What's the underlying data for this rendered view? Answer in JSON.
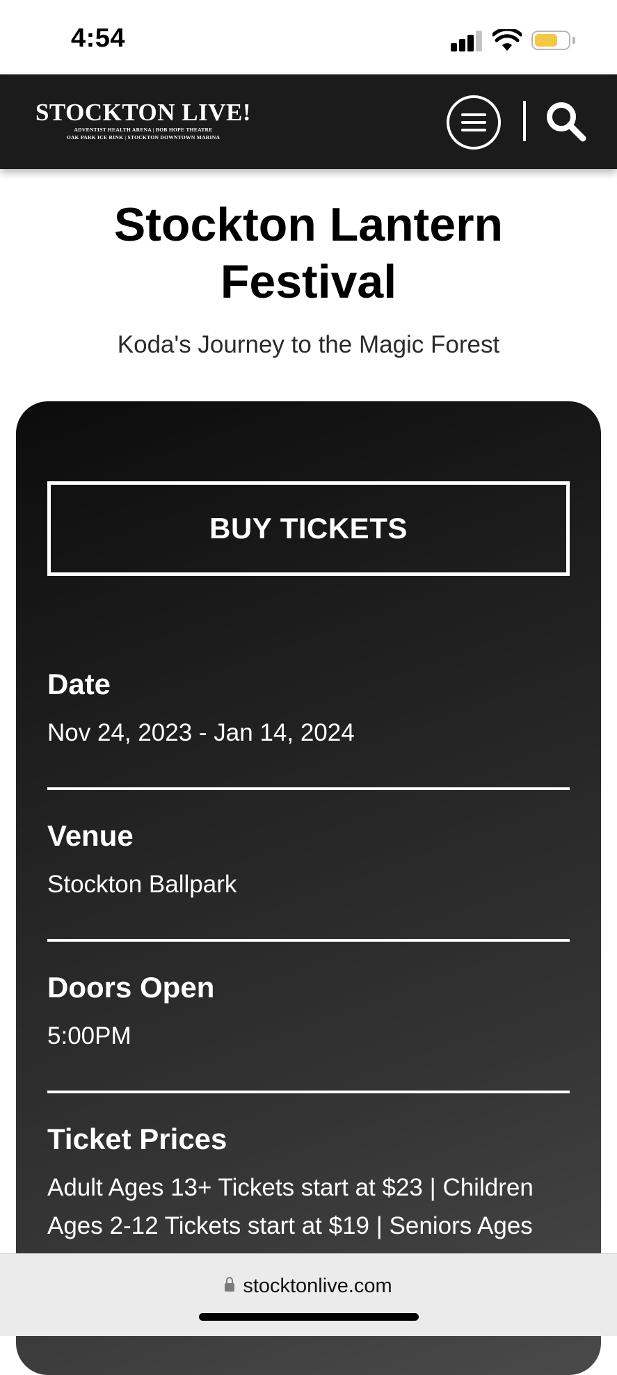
{
  "status_bar": {
    "time": "4:54",
    "battery_color": "#f5c842"
  },
  "header": {
    "logo_title": "STOCKTON LIVE!",
    "logo_sub_line1": "ADVENTIST HEALTH ARENA | BOB HOPE THEATRE",
    "logo_sub_line2": "OAK PARK ICE RINK | STOCKTON DOWNTOWN MARINA",
    "icons": [
      "menu-icon",
      "search-icon"
    ]
  },
  "event": {
    "title_line1": "Stockton Lantern",
    "title_line2": "Festival",
    "subtitle": "Koda's Journey to the Magic Forest"
  },
  "card": {
    "buy_label": "BUY TICKETS",
    "date_heading": "Date",
    "date_value": "Nov 24, 2023 - Jan 14, 2024",
    "venue_heading": "Venue",
    "venue_value": "Stockton Ballpark",
    "doors_heading": "Doors Open",
    "doors_value": "5:00PM",
    "prices_heading": "Ticket Prices",
    "prices_line1": "Adult Ages 13+ Tickets start at $23 | Children",
    "prices_line2": "Ages 2-12 Tickets start at $19 | Seniors Ages"
  },
  "browser": {
    "url": "stocktonlive.com"
  }
}
